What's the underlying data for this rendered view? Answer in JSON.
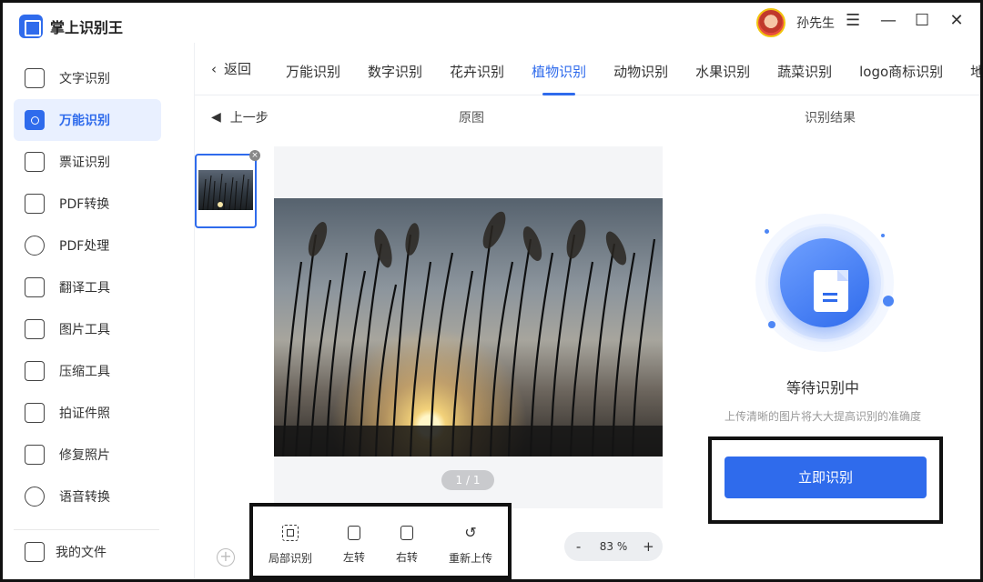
{
  "app": {
    "name": "掌上识别王"
  },
  "user": {
    "name": "孙先生"
  },
  "window_controls": {
    "menu": "☰",
    "minimize": "—",
    "maximize": "☐",
    "close": "✕"
  },
  "sidebar": {
    "items": [
      {
        "label": "文字识别",
        "icon": "text-icon",
        "active": false
      },
      {
        "label": "万能识别",
        "icon": "scan-icon",
        "active": true
      },
      {
        "label": "票证识别",
        "icon": "ticket-icon",
        "active": false
      },
      {
        "label": "PDF转换",
        "icon": "pdf-convert-icon",
        "active": false
      },
      {
        "label": "PDF处理",
        "icon": "pdf-process-icon",
        "active": false
      },
      {
        "label": "翻译工具",
        "icon": "translate-icon",
        "active": false
      },
      {
        "label": "图片工具",
        "icon": "image-tool-icon",
        "active": false
      },
      {
        "label": "压缩工具",
        "icon": "compress-icon",
        "active": false
      },
      {
        "label": "拍证件照",
        "icon": "id-photo-icon",
        "active": false
      },
      {
        "label": "修复照片",
        "icon": "repair-photo-icon",
        "active": false
      },
      {
        "label": "语音转换",
        "icon": "voice-icon",
        "active": false
      }
    ],
    "my_files": "我的文件"
  },
  "tabs": {
    "back": "返回",
    "items": [
      "万能识别",
      "数字识别",
      "花卉识别",
      "植物识别",
      "动物识别",
      "水果识别",
      "蔬菜识别",
      "logo商标识别",
      "地"
    ],
    "active": "植物识别"
  },
  "workspace": {
    "prev_step": "上一步",
    "original_label": "原图",
    "result_label": "识别结果",
    "page_indicator": "1 / 1",
    "tools": [
      "局部识别",
      "左转",
      "右转",
      "重新上传"
    ],
    "zoom": {
      "minus": "-",
      "value": "83 %",
      "plus": "+"
    }
  },
  "result": {
    "status_title": "等待识别中",
    "tip": "上传清晰的图片将大大提高识别的准确度",
    "recognize_button": "立即识别"
  },
  "colors": {
    "accent": "#2f6bec",
    "active_bg": "#e9f0ff"
  }
}
